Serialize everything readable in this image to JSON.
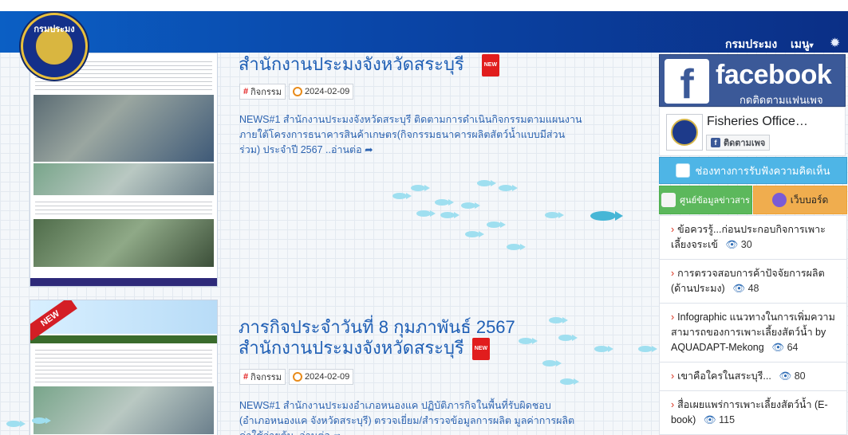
{
  "nav": {
    "logo_text": "กรมประมง",
    "items": [
      "กรมประมง",
      "เมนู"
    ],
    "menu_caret": "▾"
  },
  "posts": [
    {
      "title": "สำนักงานประมงจังหวัดสระบุรี",
      "badge": "NEW",
      "tag": "กิจกรรม",
      "date": "2024-02-09",
      "excerpt": "NEWS#1 สำนักงานประมงจังหวัดสระบุรี ติดตามการดำเนินกิจกรรมตามแผนงาน ภายใต้โครงการธนาคารสินค้าเกษตร(กิจกรรมธนาคารผลิตสัตว์น้ำแบบมีส่วนร่วม) ประจำปี 2567 ..อ่านต่อ"
    },
    {
      "title": "ภารกิจประจำวันที่ 8 กุมภาพันธ์ 2567 สำนักงานประมงจังหวัดสระบุรี",
      "badge": "NEW",
      "ribbon": "NEW",
      "tag": "กิจกรรม",
      "date": "2024-02-09",
      "excerpt": "NEWS#1 สำนักงานประมงอำเภอหนองแค ปฏิบัติภารกิจในพื้นที่รับผิดชอบ (อำเภอหนองแค จังหวัดสระบุรี) ตรวจเยี่ยม/สำรวจข้อมูลการผลิต มูลค่าการผลิต ค่าใช้จ่ายต้น..อ่านต่อ"
    }
  ],
  "sidebar": {
    "facebook": {
      "logo": "f",
      "word": "facebook",
      "subtitle": "กดติดตามแฟนเพจ",
      "page_name": "Fisheries Office…",
      "follow": "ติดตามเพจ"
    },
    "feedback_button": "ช่องทางการรับฟังความคิดเห็น",
    "news_button": "ศูนย์ข้อมูลข่าวสาร",
    "board_button": "เว็บบอร์ด",
    "list": [
      {
        "title": "ข้อควรรู้...ก่อนประกอบกิจการเพาะเลี้ยงจระเข้",
        "views": "30"
      },
      {
        "title": "การตรวจสอบการค้าปัจจัยการผลิต (ด้านประมง)",
        "views": "48"
      },
      {
        "title": "Infographic แนวทางในการเพิ่มความสามารถของการเพาะเลี้ยงสัตว์น้ำ by AQUADAPT-Mekong",
        "views": "64"
      },
      {
        "title": "เขาคือใครในสระบุรี...",
        "views": "80"
      },
      {
        "title": "สื่อเผยแพร่การเพาะเลี้ยงสัตว์น้ำ (E-book)",
        "views": "115"
      }
    ]
  },
  "icons": {
    "chevron": "›",
    "eye": "👁",
    "share": "➦",
    "gear": "✹"
  },
  "colors": {
    "nav_gradient_start": "#0b5fc4",
    "nav_gradient_end": "#0b2f86",
    "title_blue": "#1f5fb5",
    "facebook_blue": "#3b5998",
    "feedback_blue": "#4eb5e6",
    "news_green": "#5cb85c",
    "board_orange": "#f0ad4e",
    "badge_red": "#e11d1d"
  }
}
